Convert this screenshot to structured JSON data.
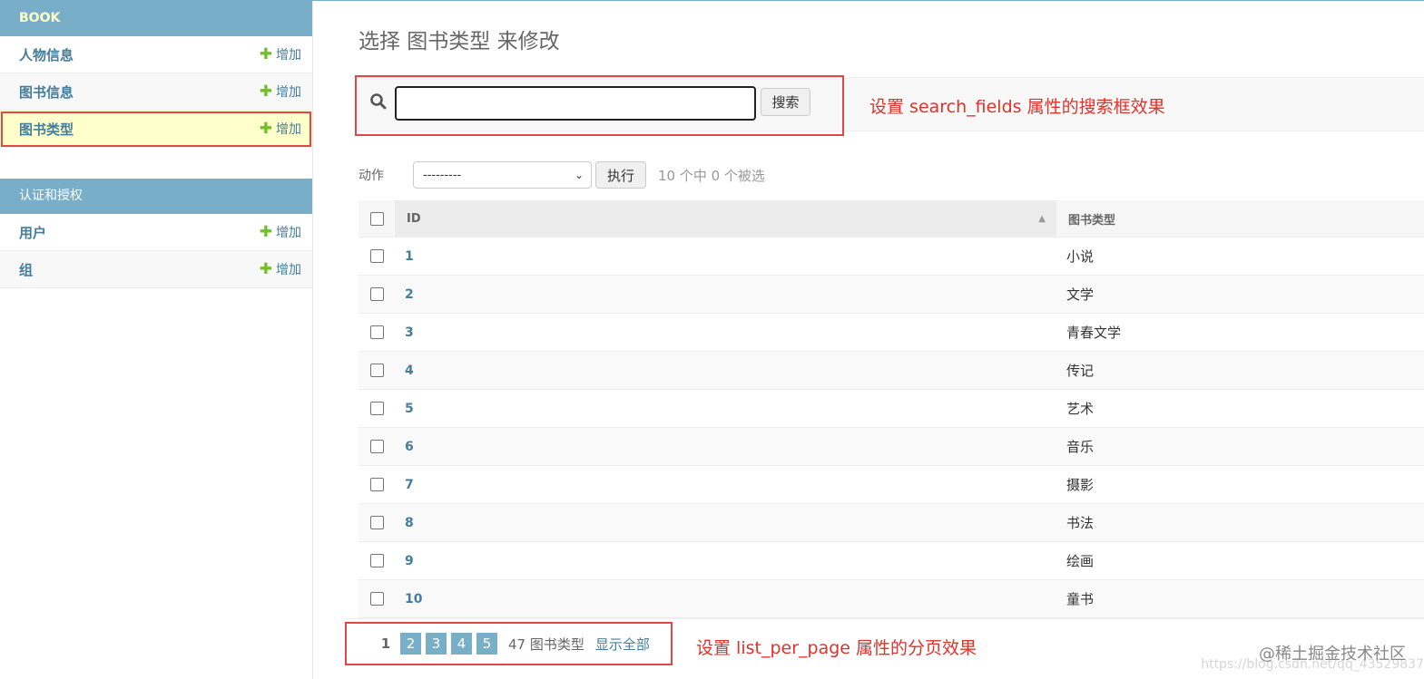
{
  "sidebar": {
    "modules": [
      {
        "caption": "BOOK",
        "rows": [
          {
            "name": "人物信息",
            "add": "增加"
          },
          {
            "name": "图书信息",
            "add": "增加"
          },
          {
            "name": "图书类型",
            "add": "增加"
          }
        ]
      },
      {
        "caption": "认证和授权",
        "rows": [
          {
            "name": "用户",
            "add": "增加"
          },
          {
            "name": "组",
            "add": "增加"
          }
        ]
      }
    ]
  },
  "main": {
    "title": "选择 图书类型 来修改",
    "search": {
      "value": "",
      "button": "搜索",
      "annotation": "设置 search_fields 属性的搜索框效果"
    },
    "actions": {
      "label": "动作",
      "selected": "---------",
      "go": "执行",
      "counter": "10 个中 0 个被选"
    },
    "table": {
      "columns": [
        "ID",
        "图书类型"
      ],
      "rows": [
        {
          "id": "1",
          "type": "小说"
        },
        {
          "id": "2",
          "type": "文学"
        },
        {
          "id": "3",
          "type": "青春文学"
        },
        {
          "id": "4",
          "type": "传记"
        },
        {
          "id": "5",
          "type": "艺术"
        },
        {
          "id": "6",
          "type": "音乐"
        },
        {
          "id": "7",
          "type": "摄影"
        },
        {
          "id": "8",
          "type": "书法"
        },
        {
          "id": "9",
          "type": "绘画"
        },
        {
          "id": "10",
          "type": "童书"
        }
      ]
    },
    "paginator": {
      "current": "1",
      "pages": [
        "2",
        "3",
        "4",
        "5"
      ],
      "count": "47 图书类型",
      "show_all": "显示全部",
      "annotation": "设置 list_per_page 属性的分页效果"
    }
  },
  "watermark": "@稀土掘金技术社区",
  "watermark_url": "https://blog.csdn.net/qq_43529837",
  "colors": {
    "accent": "#79aec8",
    "link": "#447e9b",
    "add": "#70bf2b",
    "highlight": "#ffffcc",
    "annotation": "#e0322a"
  }
}
